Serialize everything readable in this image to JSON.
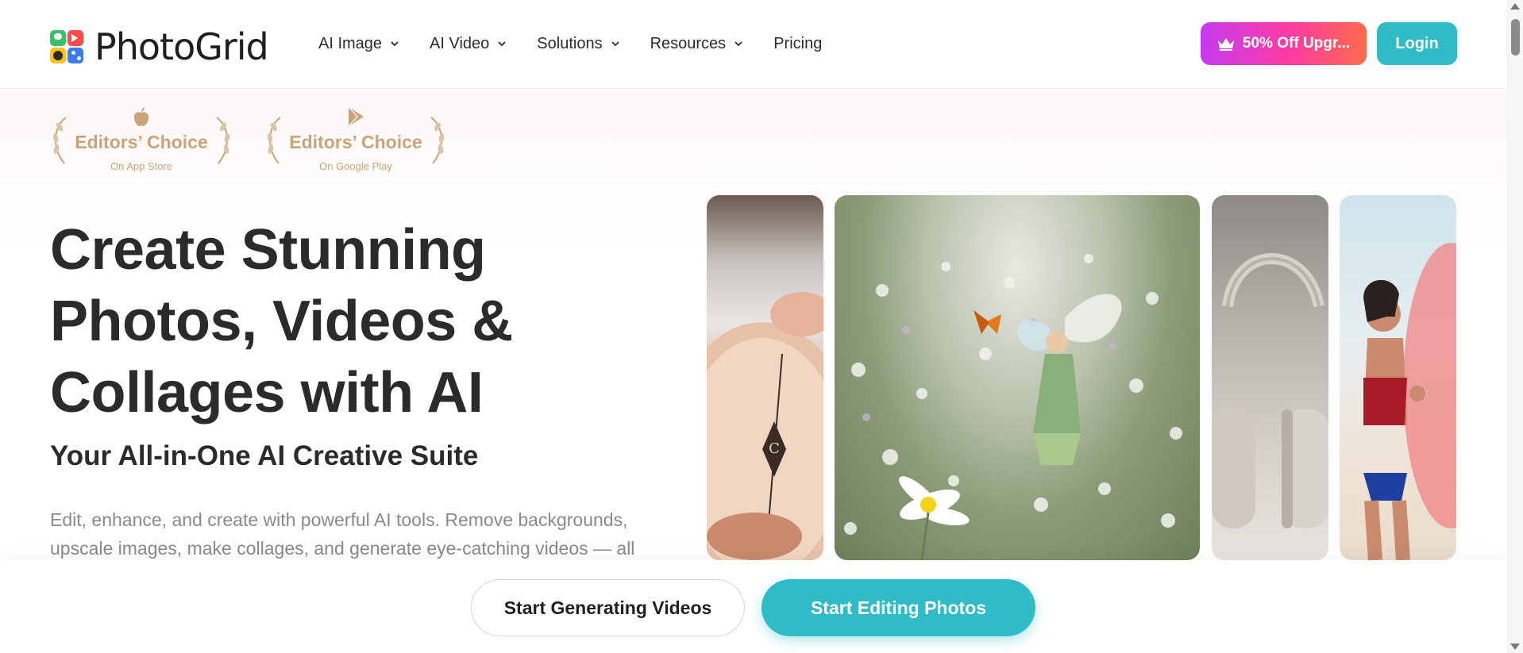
{
  "header": {
    "logo_text": "PhotoGrid",
    "nav": [
      {
        "label": "AI Image",
        "has_dropdown": true
      },
      {
        "label": "AI Video",
        "has_dropdown": true
      },
      {
        "label": "Solutions",
        "has_dropdown": true
      },
      {
        "label": "Resources",
        "has_dropdown": true
      },
      {
        "label": "Pricing",
        "has_dropdown": false
      }
    ],
    "upgrade_label": "50% Off Upgr...",
    "login_label": "Login"
  },
  "badges": [
    {
      "title": "Editors’ Choice",
      "subtitle": "On App Store",
      "icon": "apple-icon"
    },
    {
      "title": "Editors’ Choice",
      "subtitle": "On Google Play",
      "icon": "google-play-icon"
    }
  ],
  "hero": {
    "title": "Create Stunning Photos, Videos & Collages with AI",
    "subtitle": "Your All-in-One AI Creative Suite",
    "description": "Edit, enhance, and create with powerful AI tools. Remove backgrounds, upscale images, make collages, and generate eye-catching videos — all"
  },
  "cta": {
    "secondary_label": "Start Generating Videos",
    "primary_label": "Start Editing Photos"
  },
  "colors": {
    "accent": "#2fbcc7",
    "gold": "#c9a47a",
    "text": "#2b2b2b",
    "muted": "#8a8a8a"
  }
}
